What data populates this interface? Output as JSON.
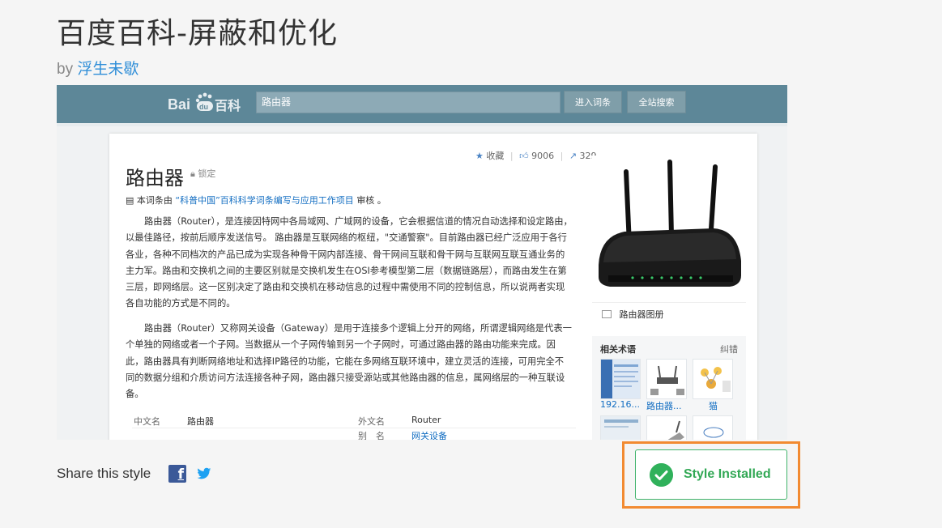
{
  "header": {
    "title": "百度百科-屏蔽和优化",
    "by_label": "by",
    "author": "浮生未歇"
  },
  "preview": {
    "site_logo_text": "Bai百科",
    "search_value": "路由器",
    "enter_button": "进入词条",
    "site_search_button": "全站搜索",
    "favorite": "收藏",
    "likes": "9006",
    "shares": "329",
    "lemma_title": "路由器",
    "lock_label": "锁定",
    "source_prefix": "本词条由",
    "source_link": "“科普中国”百科科学词条编写与应用工作项目",
    "source_suffix": "审核 。",
    "paragraph1": "路由器（Router），是连接因特网中各局域网、广域网的设备，它会根据信道的情况自动选择和设定路由，以最佳路径，按前后顺序发送信号。 路由器是互联网络的枢纽，\"交通警察\"。目前路由器已经广泛应用于各行各业，各种不同档次的产品已成为实现各种骨干网内部连接、骨干网间互联和骨干网与互联网互联互通业务的主力军。路由和交换机之间的主要区别就是交换机发生在OSI参考模型第二层（数据链路层），而路由发生在第三层，即网络层。这一区别决定了路由和交换机在移动信息的过程中需使用不同的控制信息，所以说两者实现各自功能的方式是不同的。",
    "paragraph2": "路由器（Router）又称网关设备（Gateway）是用于连接多个逻辑上分开的网络，所谓逻辑网络是代表一个单独的网络或者一个子网。当数据从一个子网传输到另一个子网时，可通过路由器的路由功能来完成。因此，路由器具有判断网络地址和选择IP路径的功能，它能在多网络互联环境中，建立灵活的连接，可用完全不同的数据分组和介质访问方法连接各种子网，路由器只接受源站或其他路由器的信息，属网络层的一种互联设备。",
    "info": {
      "cn_name_key": "中文名",
      "cn_name_val": "路由器",
      "foreign_key": "外文名",
      "foreign_val": "Router",
      "alias_key": "别　名",
      "alias_val": "网关设备"
    },
    "album_label": "路由器图册",
    "related_title": "相关术语",
    "related_correct": "纠错",
    "related_items": [
      "192.16...",
      "路由器...",
      "猫"
    ]
  },
  "share": {
    "label": "Share this style"
  },
  "install": {
    "label": "Style Installed"
  },
  "colors": {
    "accent_green": "#30b15b",
    "highlight_orange": "#f28a31",
    "link_blue": "#136ec2",
    "baike_bar": "#5d8798"
  }
}
